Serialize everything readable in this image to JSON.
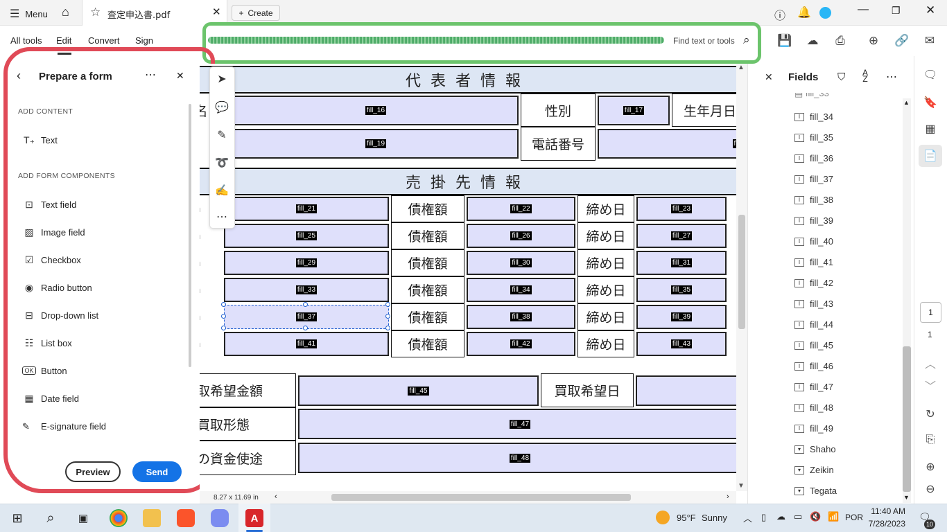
{
  "tabbar": {
    "menu_label": "Menu",
    "tab_title": "査定申込書.pdf",
    "create_label": "Create"
  },
  "menubar": {
    "items": [
      "All tools",
      "Edit",
      "Convert",
      "Sign"
    ],
    "search_placeholder": "Find text or tools"
  },
  "left_panel": {
    "title": "Prepare a form",
    "section_add_content": "ADD CONTENT",
    "text_tool": "Text",
    "section_form_components": "ADD FORM COMPONENTS",
    "components": [
      "Text field",
      "Image field",
      "Checkbox",
      "Radio button",
      "Drop-down list",
      "List box",
      "Button",
      "Date field",
      "E-signature field"
    ],
    "preview_label": "Preview",
    "send_label": "Send"
  },
  "document": {
    "header1": "代表者情報",
    "header2": "売掛先情報",
    "gender_label": "性別",
    "birth_label": "生年月日",
    "phone_label": "電話番号",
    "name_partial": "名",
    "debt_label": "債権額",
    "close_label": "締め日",
    "left_partial": "n",
    "amount_label": "取希望金額",
    "date_label": "買取希望日",
    "form_label": "買取形態",
    "usage_label": "の資金使途",
    "fields": {
      "f16": "fill_16",
      "f17": "fill_17",
      "f19": "fill_19",
      "f21": "fill_21",
      "f22": "fill_22",
      "f23": "fill_23",
      "f25": "fill_25",
      "f26": "fill_26",
      "f27": "fill_27",
      "f29": "fill_29",
      "f30": "fill_30",
      "f31": "fill_31",
      "f33": "fill_33",
      "f34": "fill_34",
      "f35": "fill_35",
      "f37": "fill_37",
      "f38": "fill_38",
      "f39": "fill_39",
      "f41": "fill_41",
      "f42": "fill_42",
      "f43": "fill_43",
      "f45": "fill_45",
      "f47": "fill_47",
      "f48": "fill_48",
      "f_cut": "fill"
    }
  },
  "status": {
    "page_size": "8.27 x 11.69 in"
  },
  "right_panel": {
    "title": "Fields",
    "items": [
      "fill_34",
      "fill_35",
      "fill_36",
      "fill_37",
      "fill_38",
      "fill_39",
      "fill_40",
      "fill_41",
      "fill_42",
      "fill_43",
      "fill_44",
      "fill_45",
      "fill_46",
      "fill_47",
      "fill_48",
      "fill_49",
      "Shaho",
      "Zeikin",
      "Tegata"
    ],
    "page_current": "1",
    "page_total": "1"
  },
  "taskbar": {
    "weather_temp": "95°F",
    "weather_desc": "Sunny",
    "lang": "POR",
    "time": "11:40 AM",
    "date": "7/28/2023",
    "notif_count": "10"
  },
  "colors": {
    "accent": "#1473e6",
    "highlight_outline": "#e04a57",
    "search_outline": "#6cc46c",
    "field_fill": "#dfe0fb",
    "header_fill": "#dde6f4"
  }
}
